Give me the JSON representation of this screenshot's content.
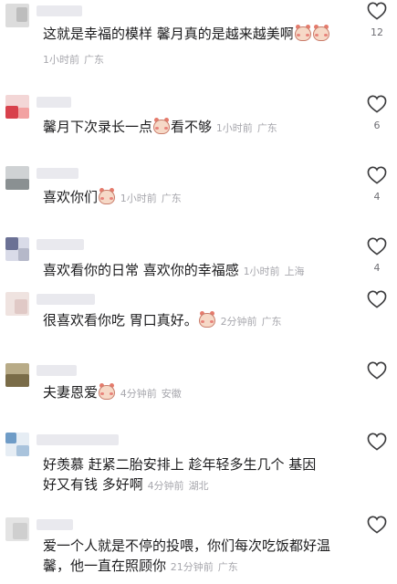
{
  "comments": [
    {
      "text": "这就是幸福的模样  馨月真的是越来越美啊",
      "emoji_count": 2,
      "time": "1小时前",
      "location": "广东",
      "likes": "12"
    },
    {
      "text": "馨月下次录长一点",
      "text_after": "看不够",
      "time": "1小时前",
      "location": "广东",
      "likes": "6"
    },
    {
      "text": "喜欢你们",
      "time": "1小时前",
      "location": "广东",
      "likes": "4"
    },
    {
      "text": "喜欢看你的日常  喜欢你的幸福感",
      "time": "1小时前",
      "location": "上海",
      "likes": "4"
    },
    {
      "text": "很喜欢看你吃  胃口真好。",
      "time": "2分钟前",
      "location": "广东",
      "likes": ""
    },
    {
      "text": "夫妻恩爱",
      "time": "4分钟前",
      "location": "安徽",
      "likes": ""
    },
    {
      "line1": "好羡慕  赶紧二胎安排上  趁年轻多生几个   基因",
      "line2": "好又有钱  多好啊",
      "time": "4分钟前",
      "location": "湖北",
      "likes": ""
    },
    {
      "line1": "爱一个人就是不停的投喂，你们每次吃饭都好温",
      "line2": "馨，他一直在照顾你",
      "time": "21分钟前",
      "location": "广东",
      "likes": ""
    }
  ],
  "icons": {
    "like": "heart-outline-icon",
    "emoji": "pig-face-emoji-icon"
  },
  "colors": {
    "text": "#1c1c1e",
    "meta": "#a7a7ad",
    "icon": "#3a3a3c"
  }
}
